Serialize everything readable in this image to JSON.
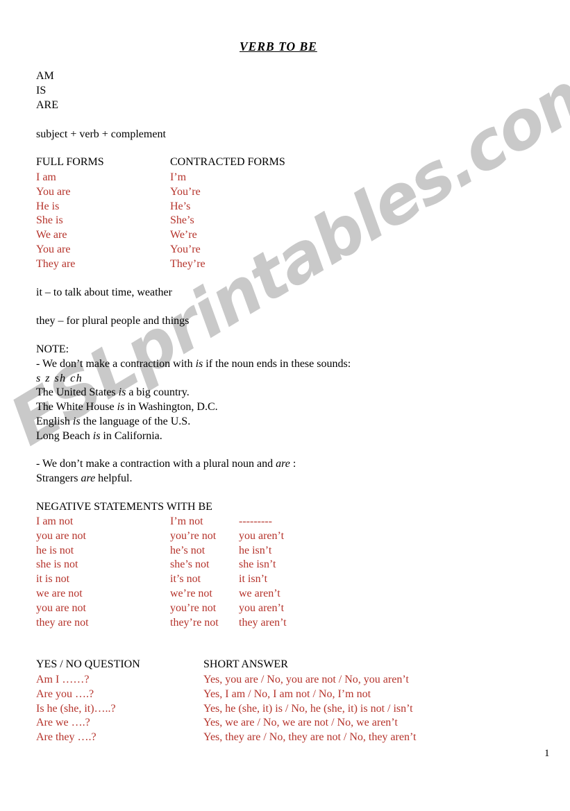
{
  "document": {
    "title": "VERB  TO  BE",
    "page_number": "1",
    "watermark": "ESLprintables.com",
    "accent_red": "#b5332b",
    "text_black": "#000000"
  },
  "forms_list": [
    "AM",
    "IS",
    "ARE"
  ],
  "structure_line": "subject + verb + complement",
  "forms_table": {
    "header_full": "FULL FORMS",
    "header_contracted": "CONTRACTED FORMS",
    "full": [
      "I am",
      "You are",
      "He is",
      "She is",
      "We are",
      "You are",
      "They are"
    ],
    "contracted": [
      "I’m",
      "You’re",
      "He’s",
      "She’s",
      "We’re",
      "You’re",
      "They’re"
    ]
  },
  "usage_notes": {
    "it_line": "it – to talk about time, weather",
    "they_line": "they – for plural people and things"
  },
  "note": {
    "label": "NOTE:",
    "rule_is_pre": "- We don’t make a contraction with ",
    "rule_is_italic": "is",
    "rule_is_post": " if the noun ends in these sounds:",
    "sounds": "s   z   sh   ch",
    "examples": [
      {
        "pre": "The United States ",
        "it": "is",
        "post": " a big country."
      },
      {
        "pre": "The White House ",
        "it": "is",
        "post": " in Washington, D.C."
      },
      {
        "pre": "English ",
        "it": "is",
        "post": " the language of the U.S."
      },
      {
        "pre": "Long Beach ",
        "it": "is",
        "post": " in California."
      }
    ],
    "rule_are_pre": "- We don’t make a contraction with a plural noun and ",
    "rule_are_italic": "are",
    "rule_are_post": " :",
    "are_example_pre": "Strangers ",
    "are_example_italic": "are",
    "are_example_post": " helpful."
  },
  "negatives": {
    "heading": "NEGATIVE STATEMENTS WITH BE",
    "full": [
      "I am not",
      "you are not",
      "he is not",
      "she is not",
      "it is not",
      "we are not",
      "you are not",
      "they are not"
    ],
    "contracted_a": [
      "I’m not",
      "you’re not",
      "he’s not",
      "she’s not",
      "it’s not",
      "we’re not",
      "you’re not",
      "they’re not"
    ],
    "contracted_b": [
      "---------",
      "you aren’t",
      "he isn’t",
      "she isn’t",
      "it isn’t",
      "we aren’t",
      "you aren’t",
      "they aren’t"
    ]
  },
  "questions": {
    "heading_question": "YES / NO QUESTION",
    "heading_answer": "SHORT ANSWER",
    "questions": [
      "Am I  ……?",
      "Are you ….?",
      "Is he (she, it)…..?",
      "Are we ….?",
      "Are they ….?"
    ],
    "answers": [
      "Yes, you are / No, you are not / No, you aren’t",
      "Yes, I am / No, I am not / No, I’m not",
      "Yes, he (she, it) is / No, he (she, it) is not / isn’t",
      "Yes, we are / No, we are not / No, we aren’t",
      "Yes, they are / No, they are not / No, they aren’t"
    ]
  }
}
